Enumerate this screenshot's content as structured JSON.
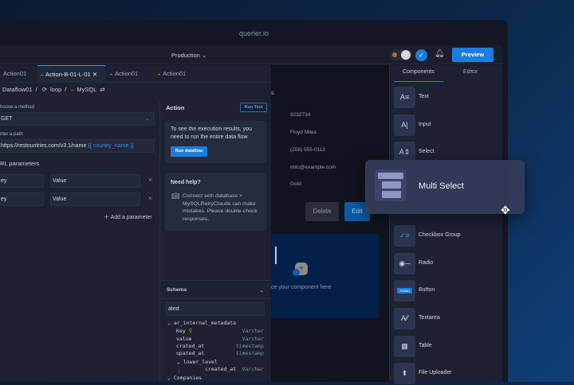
{
  "app": {
    "title": "querier.io",
    "environment": "Production",
    "preview_label": "Preview"
  },
  "tabs": [
    {
      "label": "Action01"
    },
    {
      "label": "Action-B-01-L-01"
    },
    {
      "label": "Action01"
    },
    {
      "label": "Action01"
    }
  ],
  "breadcrumb": [
    "Dataflow01",
    "loop",
    "MySQL"
  ],
  "form": {
    "method_label": "hoose a method",
    "method_value": "GET",
    "path_label": "nter a path",
    "path_value": "https://restountries.com/v3.1/name",
    "path_var": "{{ country_name }}",
    "params_label": "RL parameters",
    "params": [
      {
        "key": "ey",
        "value": "Value"
      },
      {
        "key": "ey",
        "value": "Value"
      }
    ],
    "add_param": "Add a parameter"
  },
  "action": {
    "title": "Action",
    "run_test": "Run Test",
    "info": "To see the execution results, you need to run the entire data flow",
    "run_dataflow": "Run dataflow",
    "help_title": "Need help?",
    "help_text": "Connect with database > MySQLRetryClaude can make mistakes. Please double-check responses."
  },
  "schema": {
    "title": "Schema",
    "search": "ated",
    "table": "ar_internal_metadata",
    "columns": [
      {
        "name": "Key",
        "type": "Varchar"
      },
      {
        "name": "value",
        "type": "Varchar"
      },
      {
        "name": "crated_at",
        "type": "timestamp"
      },
      {
        "name": "upated_at",
        "type": "timestamp"
      }
    ],
    "sub": "lower_level",
    "sub_columns": [
      {
        "name": "created_at",
        "type": "Varchar"
      }
    ],
    "next_table": "Companies"
  },
  "canvas": {
    "heading": "s",
    "values": [
      "9232734",
      "Floyd Miles",
      "(208) 555-0112",
      "mitc@example.com",
      "Gold"
    ],
    "delete": "Delete",
    "edit": "Edit",
    "drop_hint": "ce your component here"
  },
  "components": {
    "tabs": [
      "Components",
      "Editor"
    ],
    "items": [
      "Text",
      "Input",
      "Select",
      "Checkbox Group",
      "Radio",
      "Button",
      "Textarea",
      "Table",
      "File Uploader"
    ],
    "button_icon_text": "Action",
    "dragging": "Multi Select"
  }
}
